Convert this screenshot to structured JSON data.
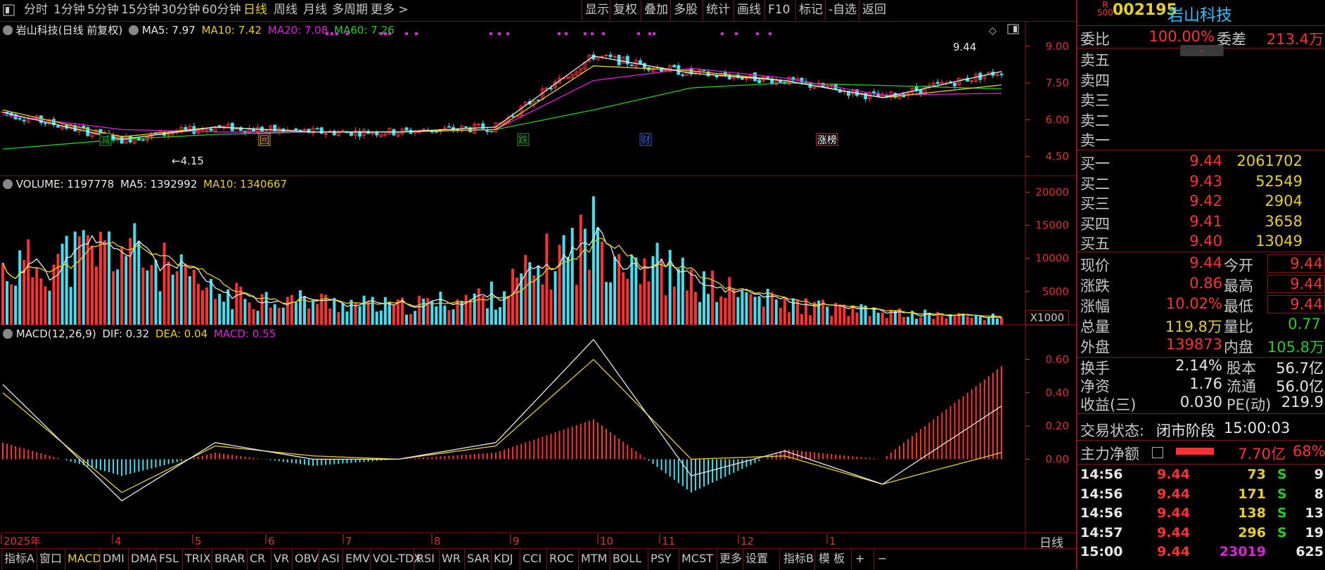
{
  "toolbar": {
    "periods": [
      "分时",
      "1分钟",
      "5分钟",
      "15分钟",
      "30分钟",
      "60分钟",
      "日线",
      "周线",
      "月线",
      "多周期",
      "更多 >"
    ],
    "active": "日线",
    "right": [
      "显示",
      "复权",
      "叠加",
      "多股",
      "统计",
      "画线",
      "F10",
      "标记",
      "-自选",
      "返回"
    ]
  },
  "main_legend": {
    "name": "岩山科技(日线 前复权)",
    "ma5": "MA5: 7.97",
    "ma10": "MA10: 7.42",
    "ma20": "MA20: 7.08",
    "ma60": "MA60: 7.26"
  },
  "price_axis": [
    "9.00",
    "7.50",
    "6.00",
    "4.50"
  ],
  "price_annotations": {
    "high": "9.44",
    "low": "4.15"
  },
  "event_tags": [
    "减",
    "回",
    "跌",
    "财",
    "涨榜"
  ],
  "volume_legend": {
    "label": "VOLUME: 1197778",
    "ma5": "MA5: 1392992",
    "ma10": "MA10: 1340667"
  },
  "volume_axis": [
    "20000",
    "15000",
    "10000",
    "5000"
  ],
  "volume_unit": "X1000",
  "macd_legend": {
    "label": "MACD(12,26,9)",
    "dif": "DIF: 0.32",
    "dea": "DEA: 0.04",
    "macd": "MACD: 0.55"
  },
  "macd_axis": [
    "0.60",
    "0.40",
    "0.20",
    "0.00"
  ],
  "time_axis": [
    "2025年",
    "4",
    "5",
    "6",
    "7",
    "8",
    "9",
    "10",
    "11",
    "12",
    "1"
  ],
  "period_label": "日线",
  "bottom_tabs": [
    "指标A",
    "窗口",
    "MACD",
    "DMI",
    "DMA",
    "FSL",
    "TRIX",
    "BRAR",
    "CR",
    "VR",
    "OBV",
    "ASI",
    "EMV",
    "VOL-TDX",
    "RSI",
    "WR",
    "SAR",
    "KDJ",
    "CCI",
    "ROC",
    "MTM",
    "BOLL",
    "PSY",
    "MCST",
    "更多",
    "设置"
  ],
  "bottom_active": "MACD",
  "bottom_right": [
    "指标B",
    "模 板",
    "+",
    "−"
  ],
  "stock": {
    "badge_top": "R",
    "badge_bottom": "500",
    "code": "002195",
    "name": "岩山科技"
  },
  "order_book": {
    "weibi_label": "委比",
    "weibi": "100.00%",
    "weicha_label": "委差",
    "weicha": "213.4万",
    "sells": [
      "卖五",
      "卖四",
      "卖三",
      "卖二",
      "卖一"
    ],
    "buys": [
      {
        "label": "买一",
        "price": "9.44",
        "vol": "2061702"
      },
      {
        "label": "买二",
        "price": "9.43",
        "vol": "52549"
      },
      {
        "label": "买三",
        "price": "9.42",
        "vol": "2904"
      },
      {
        "label": "买四",
        "price": "9.41",
        "vol": "3658"
      },
      {
        "label": "买五",
        "price": "9.40",
        "vol": "13049"
      }
    ]
  },
  "quote": [
    {
      "l1": "现价",
      "v1": "9.44",
      "c1": "red",
      "l2": "今开",
      "v2": "9.44",
      "c2": "red"
    },
    {
      "l1": "涨跌",
      "v1": "0.86",
      "c1": "red",
      "l2": "最高",
      "v2": "9.44",
      "c2": "red"
    },
    {
      "l1": "涨幅",
      "v1": "10.02%",
      "c1": "red",
      "l2": "最低",
      "v2": "9.44",
      "c2": "red"
    },
    {
      "l1": "总量",
      "v1": "119.8万",
      "c1": "yel",
      "l2": "量比",
      "v2": "0.77",
      "c2": "grn"
    },
    {
      "l1": "外盘",
      "v1": "139873",
      "c1": "red",
      "l2": "内盘",
      "v2": "105.8万",
      "c2": "grn"
    }
  ],
  "fundamentals": [
    {
      "l1": "换手",
      "v1": "2.14%",
      "l2": "股本",
      "v2": "56.7亿"
    },
    {
      "l1": "净资",
      "v1": "1.76",
      "l2": "流通",
      "v2": "56.0亿"
    },
    {
      "l1": "收益(三)",
      "v1": "0.030",
      "l2": "PE(动)",
      "v2": "219.9"
    }
  ],
  "status": {
    "label": "交易状态:",
    "value": "闭市阶段",
    "time": "15:00:03"
  },
  "main_force": {
    "label": "主力净额",
    "value": "7.70亿",
    "pct": "68%"
  },
  "ticks": [
    {
      "t": "14:56",
      "p": "9.44",
      "v": "73",
      "s": "S",
      "n": "9"
    },
    {
      "t": "14:56",
      "p": "9.44",
      "v": "171",
      "s": "S",
      "n": "8"
    },
    {
      "t": "14:56",
      "p": "9.44",
      "v": "138",
      "s": "S",
      "n": "13"
    },
    {
      "t": "14:57",
      "p": "9.44",
      "v": "296",
      "s": "S",
      "n": "19"
    },
    {
      "t": "15:00",
      "p": "9.44",
      "v": "23019",
      "s": "",
      "n": "625"
    }
  ],
  "colors": {
    "up": "#ff3030",
    "down": "#40e0f0",
    "ma5": "#e8e8e8",
    "ma10": "#e8d020",
    "ma20": "#e020e0",
    "ma60": "#20d020",
    "grid": "#8a1515"
  },
  "chart_data": {
    "type": "line",
    "title": "岩山科技(日线 前复权)",
    "x": [
      "2025-03",
      "2025-04",
      "2025-05",
      "2025-06",
      "2025-07",
      "2025-08",
      "2025-09",
      "2025-10",
      "2025-11",
      "2025-12",
      "2026-01"
    ],
    "series": [
      {
        "name": "MA5",
        "values": [
          6.3,
          5.2,
          5.7,
          5.5,
          5.5,
          5.7,
          8.6,
          7.9,
          7.6,
          6.9,
          7.97
        ]
      },
      {
        "name": "MA10",
        "values": [
          6.4,
          5.3,
          5.7,
          5.5,
          5.5,
          5.6,
          8.2,
          8.0,
          7.6,
          6.9,
          7.42
        ]
      },
      {
        "name": "MA20",
        "values": [
          6.2,
          5.6,
          5.5,
          5.5,
          5.5,
          5.6,
          7.6,
          8.1,
          7.7,
          7.0,
          7.08
        ]
      },
      {
        "name": "MA60",
        "values": [
          4.8,
          5.2,
          5.4,
          5.5,
          5.5,
          5.6,
          6.4,
          7.3,
          7.5,
          7.4,
          7.26
        ]
      }
    ],
    "ylim": [
      4.0,
      9.8
    ],
    "volume": {
      "name": "VOLUME",
      "values": [
        9000,
        13000,
        5000,
        4000,
        3000,
        5000,
        15000,
        7000,
        3500,
        2000,
        1198
      ],
      "ylim": [
        0,
        21000
      ]
    },
    "macd": {
      "name": "MACD(12,26,9)",
      "dif": [
        0.45,
        -0.25,
        0.1,
        0.0,
        0.0,
        0.1,
        0.72,
        -0.1,
        0.05,
        -0.15,
        0.32
      ],
      "dea": [
        0.4,
        -0.2,
        0.08,
        0.02,
        0.0,
        0.08,
        0.6,
        0.0,
        0.02,
        -0.15,
        0.04
      ],
      "ylim": [
        -0.4,
        0.75
      ]
    }
  }
}
